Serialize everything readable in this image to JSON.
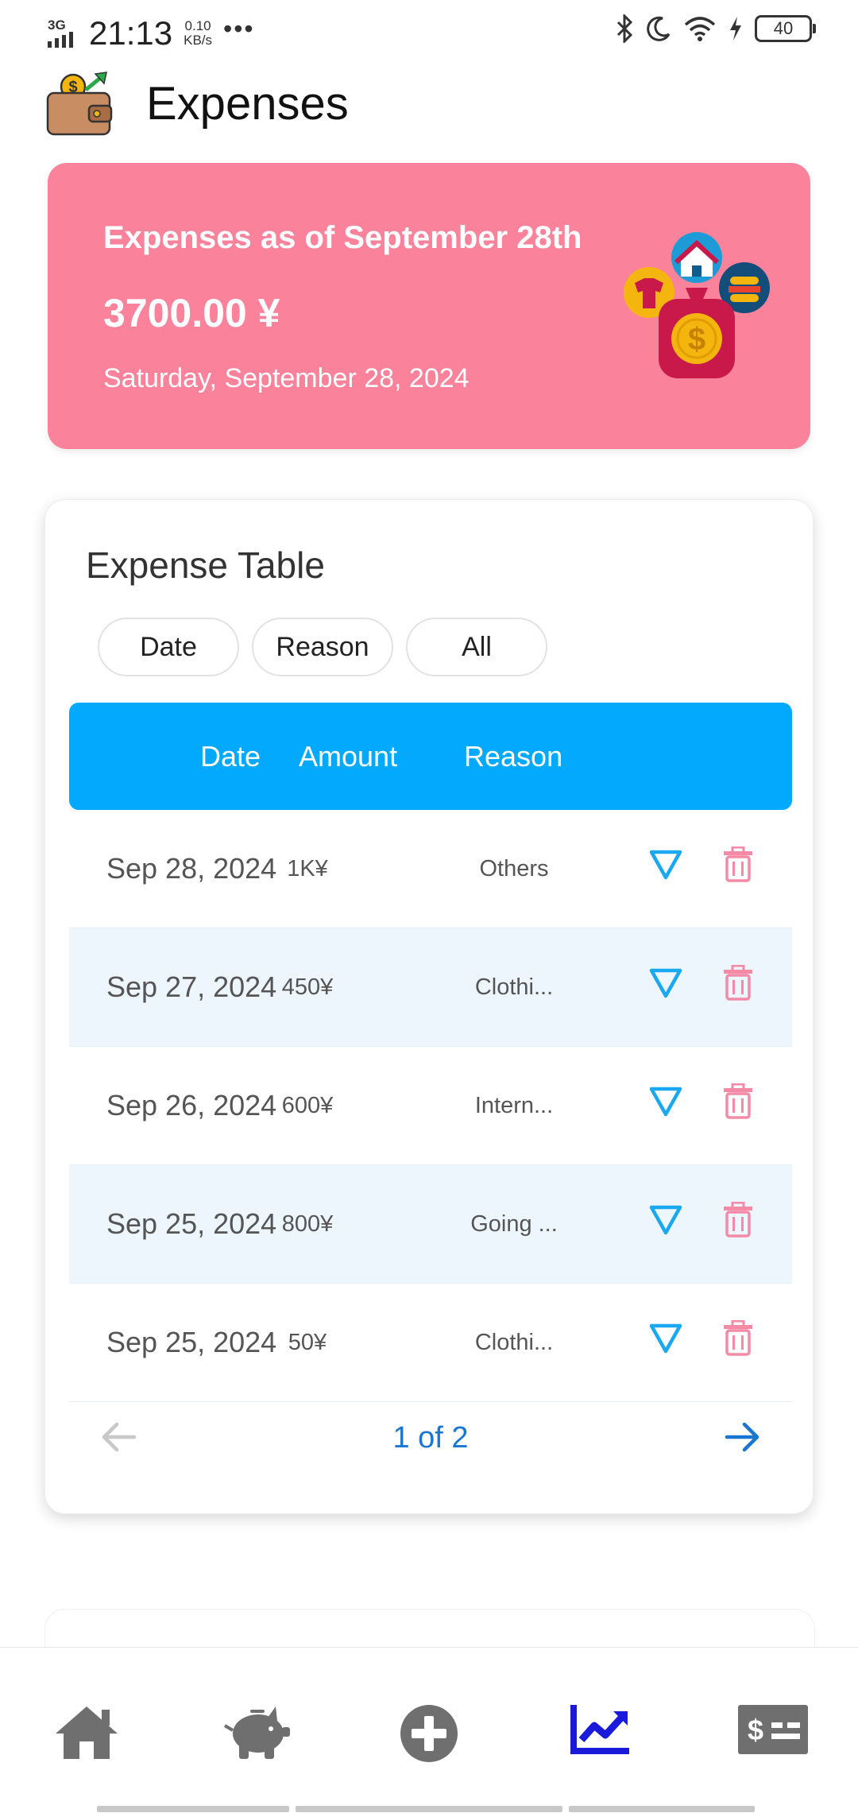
{
  "status_bar": {
    "network": "3G",
    "time": "21:13",
    "speed_value": "0.10",
    "speed_unit": "KB/s",
    "more": "•••",
    "battery": "40"
  },
  "header": {
    "title": "Expenses"
  },
  "summary": {
    "heading": "Expenses as of September 28th",
    "amount": "3700.00 ¥",
    "date": "Saturday, September 28, 2024"
  },
  "table": {
    "title": "Expense Table",
    "filters": [
      "Date",
      "Reason",
      "All"
    ],
    "columns": [
      "Date",
      "Amount",
      "Reason"
    ],
    "rows": [
      {
        "date": "Sep 28, 2024",
        "amount": "1K¥",
        "reason": "Others"
      },
      {
        "date": "Sep 27, 2024",
        "amount": "450¥",
        "reason": "Clothi..."
      },
      {
        "date": "Sep 26, 2024",
        "amount": "600¥",
        "reason": "Intern..."
      },
      {
        "date": "Sep 25, 2024",
        "amount": "800¥",
        "reason": "Going ..."
      },
      {
        "date": "Sep 25, 2024",
        "amount": "50¥",
        "reason": "Clothi..."
      }
    ],
    "pagination": {
      "label": "1 of 2"
    }
  },
  "bottom_nav": {
    "items": [
      "home-icon",
      "piggy-bank-icon",
      "add-circle-icon",
      "chart-trend-icon",
      "money-bill-icon"
    ],
    "active": "chart-trend-icon"
  },
  "colors": {
    "summary_card": "#fb829b",
    "table_header": "#02a9fc",
    "row_alt": "#eef6fd",
    "edit_icon": "#1aa9f0",
    "delete_icon": "#f48aa6",
    "active_nav": "#1a1adb",
    "inactive_nav": "#6f6f6f",
    "pager": "#1976d2"
  }
}
